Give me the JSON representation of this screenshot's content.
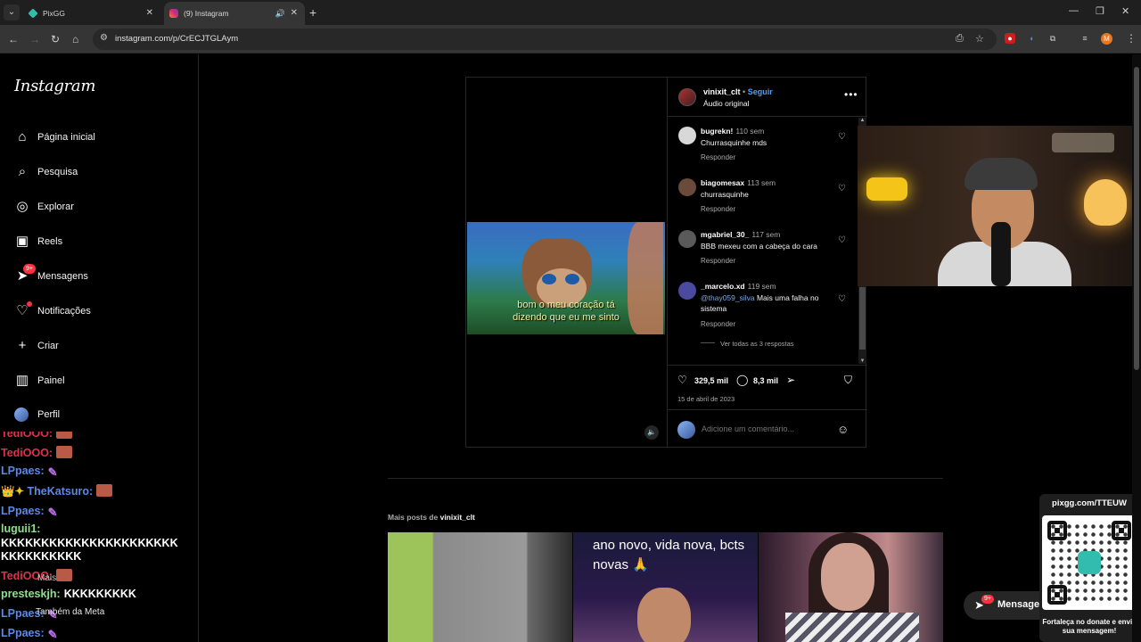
{
  "browser": {
    "tabs": [
      {
        "title": "PixGG",
        "active": false
      },
      {
        "title": "(9) Instagram",
        "active": true
      }
    ],
    "url": "instagram.com/p/CrECJTGLAym",
    "profile_initial": "M"
  },
  "sidebar": {
    "logo": "Instagram",
    "items": [
      {
        "label": "Página inicial",
        "icon": "home-icon"
      },
      {
        "label": "Pesquisa",
        "icon": "search-icon"
      },
      {
        "label": "Explorar",
        "icon": "compass-icon"
      },
      {
        "label": "Reels",
        "icon": "reels-icon"
      },
      {
        "label": "Mensagens",
        "icon": "messenger-icon",
        "badge": "9+"
      },
      {
        "label": "Notificações",
        "icon": "heart-icon",
        "dot": true
      },
      {
        "label": "Criar",
        "icon": "plus-icon"
      },
      {
        "label": "Painel",
        "icon": "dashboard-icon"
      },
      {
        "label": "Perfil",
        "icon": "avatar-icon"
      }
    ],
    "more_label": "Mais",
    "meta_label": "Também da Meta"
  },
  "chat": {
    "lines": [
      {
        "user": "TediOOO:",
        "color": "#e0304a",
        "emote": "crab"
      },
      {
        "user": "TediOOO:",
        "color": "#e0304a",
        "emote": "crab"
      },
      {
        "user": "LPpaes:",
        "color": "#5b8ae6",
        "emote": "feather"
      },
      {
        "user": "TheKatsuro:",
        "color": "#5b8ae6",
        "emote": "crab",
        "badges": "👑✦"
      },
      {
        "user": "LPpaes:",
        "color": "#5b8ae6",
        "emote": "feather"
      },
      {
        "user": "luguii1:",
        "color": "#8ee08e",
        "text": ""
      },
      {
        "user": "",
        "color": "#fff",
        "text": "KKKKKKKKKKKKKKKKKKKKKK"
      },
      {
        "user": "",
        "color": "#fff",
        "text": "KKKKKKKKKK"
      },
      {
        "user": "TediOOO:",
        "color": "#e0304a",
        "emote": "crab"
      },
      {
        "user": "presteskjh:",
        "color": "#8ee08e",
        "text": "KKKKKKKKK"
      },
      {
        "user": "LPpaes:",
        "color": "#5b8ae6",
        "emote": "feather"
      },
      {
        "user": "LPpaes:",
        "color": "#5b8ae6",
        "emote": "feather"
      }
    ]
  },
  "post": {
    "video_subtitle_1": "bom o meu coração tá",
    "video_subtitle_2": "dizendo que eu me sinto",
    "author": "vinixit_clt",
    "separator": "•",
    "follow_label": "Seguir",
    "audio_label": "Áudio original",
    "comments": [
      {
        "user": "bugrekn!",
        "time": "110 sem",
        "text": "Churrasquinhe mds",
        "reply": "Responder",
        "avatar_color": "#d8d8d8"
      },
      {
        "user": "biagomesax",
        "time": "113 sem",
        "text": "churrasquinhe",
        "reply": "Responder",
        "avatar_color": "#6a4a3a"
      },
      {
        "user": "mgabriel_30_",
        "time": "117 sem",
        "text": "BBB mexeu com a cabeça do cara",
        "reply": "Responder",
        "avatar_color": "#5a5a5a"
      },
      {
        "user": "_marcelo.xd",
        "time": "119 sem",
        "mention": "@thay059_silva",
        "text": " Mais uma falha no sistema",
        "reply": "Responder",
        "avatar_color": "#4a4aa0"
      }
    ],
    "view_replies": "Ver todas as 3 respostas",
    "likes": "329,5 mil",
    "comments_count": "8,3 mil",
    "date": "15 de abril de 2023",
    "add_comment_placeholder": "Adicione um comentário..."
  },
  "more_posts": {
    "prefix": "Mais posts de",
    "user": "vinixit_clt",
    "thumb2_text": "ano novo, vida nova, bcts novas 🙏"
  },
  "messages_pill": {
    "label": "Mensagens",
    "badge": "9+"
  },
  "qr_overlay": {
    "url": "pixgg.com/TTEUW",
    "cta": "Fortaleça no donate e envie sua mensagem!"
  }
}
